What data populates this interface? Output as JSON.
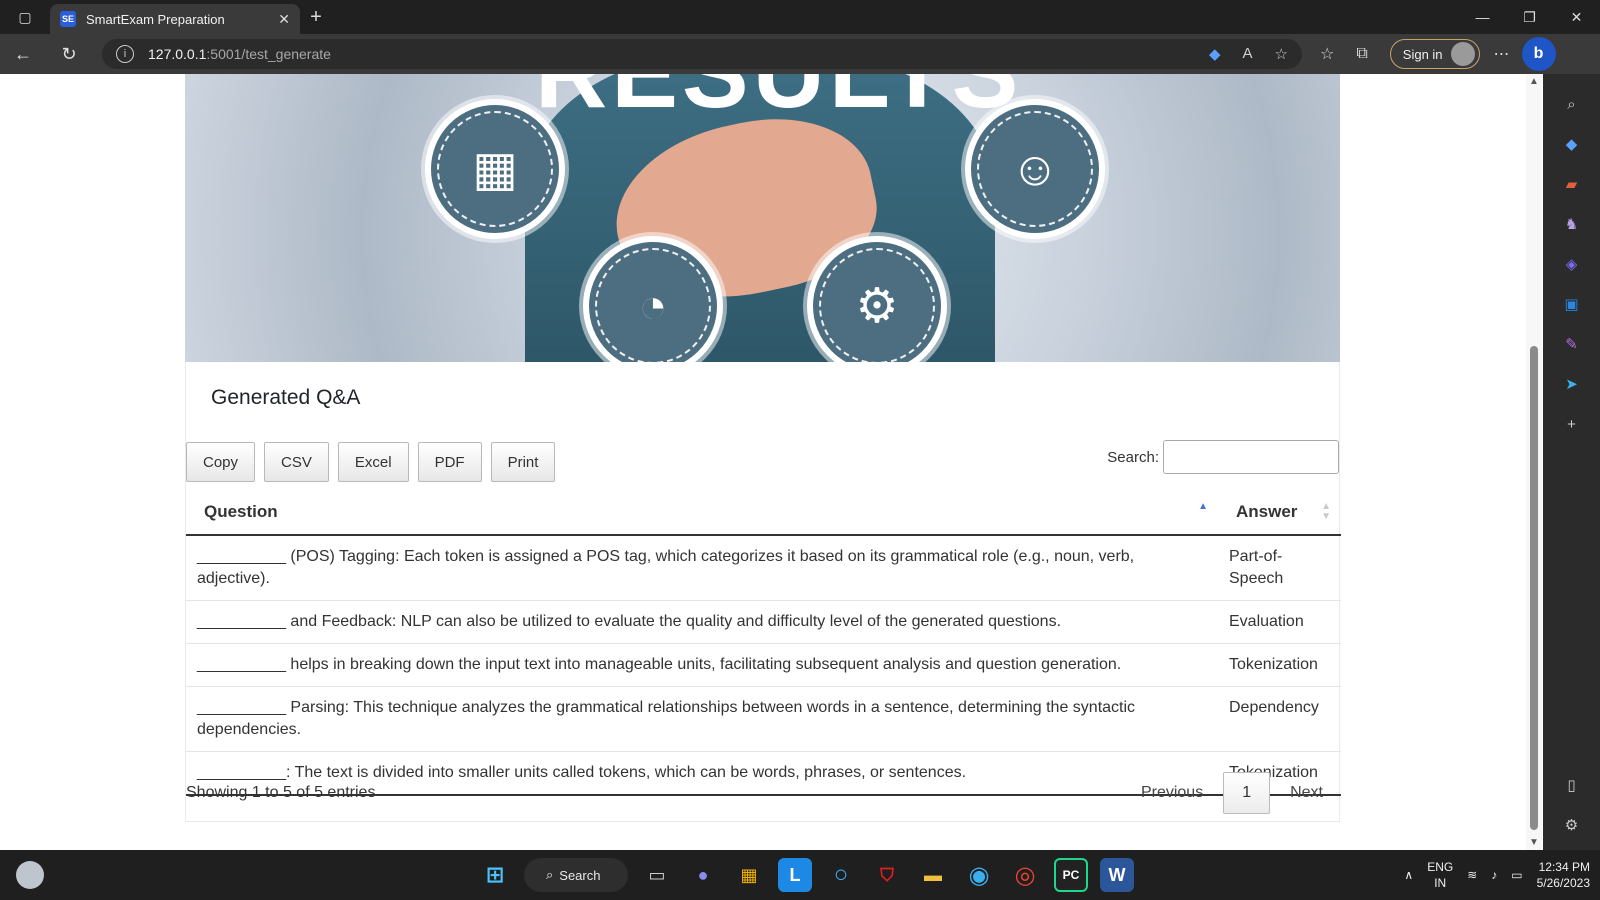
{
  "browser": {
    "tab_title": "SmartExam Preparation",
    "tab_favicon": "SE",
    "url_host": "127.0.0.1",
    "url_path": ":5001/test_generate",
    "signin_label": "Sign in",
    "copilot_label": "b"
  },
  "banner": {
    "big_text": "RESULTS"
  },
  "card": {
    "title": "Generated Q&A"
  },
  "buttons": {
    "copy": "Copy",
    "csv": "CSV",
    "excel": "Excel",
    "pdf": "PDF",
    "print": "Print"
  },
  "search": {
    "label": "Search:",
    "value": ""
  },
  "table": {
    "headers": [
      "Question",
      "Answer"
    ],
    "rows": [
      {
        "question": "__________ (POS) Tagging: Each token is assigned a POS tag, which categorizes it based on its grammatical role (e.g., noun, verb, adjective).",
        "answer": "Part-of-Speech"
      },
      {
        "question": "__________ and Feedback: NLP can also be utilized to evaluate the quality and difficulty level of the generated questions.",
        "answer": "Evaluation"
      },
      {
        "question": "__________ helps in breaking down the input text into manageable units, facilitating subsequent analysis and question generation.",
        "answer": "Tokenization"
      },
      {
        "question": "__________ Parsing: This technique analyzes the grammatical relationships between words in a sentence, determining the syntactic dependencies.",
        "answer": "Dependency"
      },
      {
        "question": "__________: The text is divided into smaller units called tokens, which can be words, phrases, or sentences.",
        "answer": "Tokenization"
      }
    ]
  },
  "footer": {
    "info": "Showing 1 to 5 of 5 entries",
    "previous": "Previous",
    "page": "1",
    "next": "Next"
  },
  "taskbar": {
    "search_label": "Search",
    "lang_top": "ENG",
    "lang_bottom": "IN",
    "time": "12:34 PM",
    "date": "5/26/2023",
    "l_app": "L",
    "w_app": "W",
    "pc_app": "PC"
  },
  "colors": {
    "sort_active": "#4a6fe0",
    "edge_blue": "#1e56c8",
    "titlebar": "#202020"
  }
}
